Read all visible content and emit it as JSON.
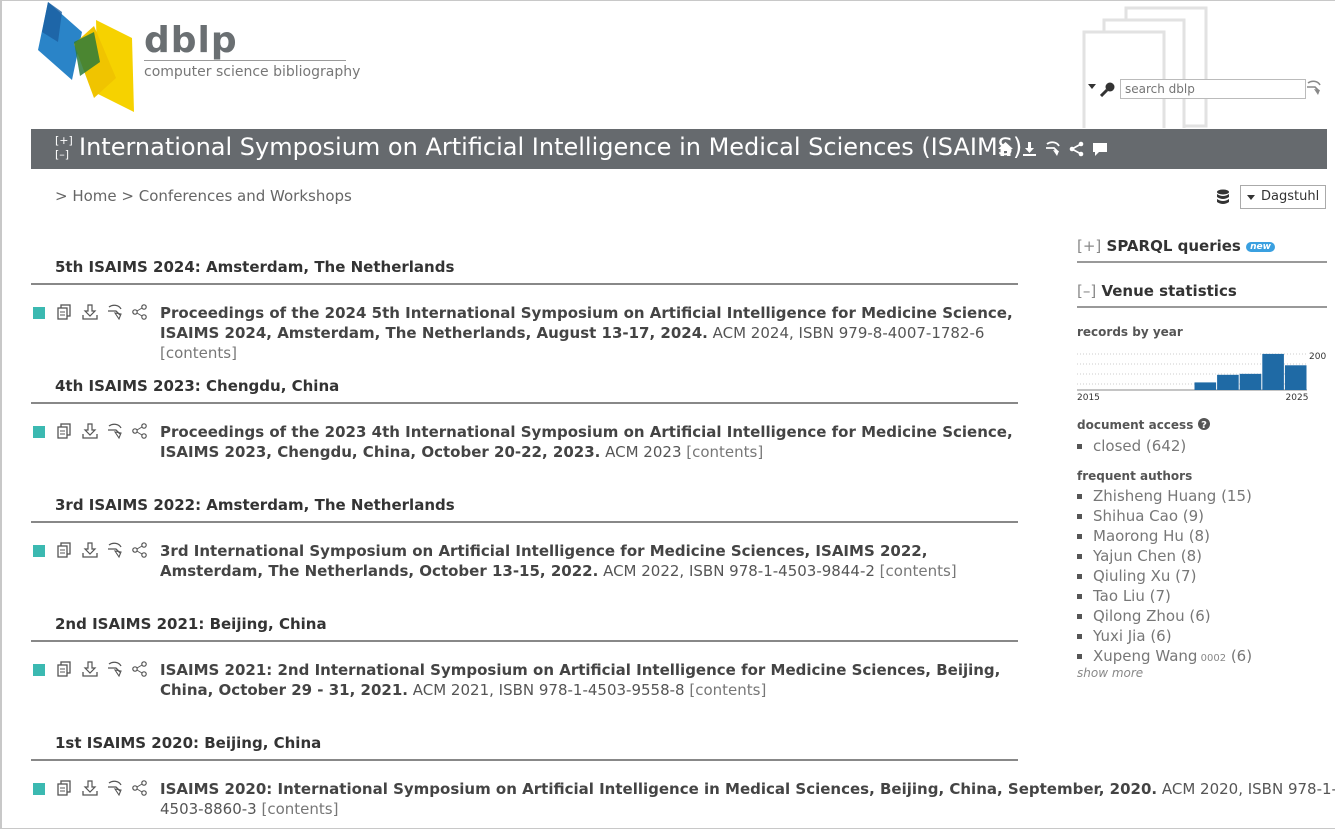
{
  "header": {
    "logo_big": "dblp",
    "logo_small": "computer science bibliography",
    "search_placeholder": "search dblp"
  },
  "title": {
    "expand": "[+]",
    "collapse": "[–]",
    "text": "International Symposium on Artificial Intelligence in Medical Sciences (ISAIMS)"
  },
  "breadcrumb": {
    "home": "> Home",
    "sep": " > ",
    "section": "Conferences and Workshops"
  },
  "mirror": {
    "selected": "Dagstuhl"
  },
  "sections": [
    {
      "heading": "5th ISAIMS 2024: Amsterdam, The Netherlands",
      "title": "Proceedings of the 2024 5th International Symposium on Artificial Intelligence for Medicine Science, ISAIMS 2024, Amsterdam, The Netherlands, August 13-17, 2024.",
      "meta": " ACM 2024, ISBN 979-8-4007-1782-6 ",
      "contents": "[contents]"
    },
    {
      "heading": "4th ISAIMS 2023: Chengdu, China",
      "title": "Proceedings of the 2023 4th International Symposium on Artificial Intelligence for Medicine Science, ISAIMS 2023, Chengdu, China, October 20-22, 2023.",
      "meta": " ACM 2023 ",
      "contents": "[contents]"
    },
    {
      "heading": "3rd ISAIMS 2022: Amsterdam, The Netherlands",
      "title": "3rd International Symposium on Artificial Intelligence for Medicine Sciences, ISAIMS 2022, Amsterdam, The Netherlands, October 13-15, 2022.",
      "meta": " ACM 2022, ISBN 978-1-4503-9844-2 ",
      "contents": "[contents]"
    },
    {
      "heading": "2nd ISAIMS 2021: Beijing, China",
      "title": "ISAIMS 2021: 2nd International Symposium on Artificial Intelligence for Medicine Sciences, Beijing, China, October 29 - 31, 2021.",
      "meta": " ACM 2021, ISBN 978-1-4503-9558-8 ",
      "contents": "[contents]"
    },
    {
      "heading": "1st ISAIMS 2020: Beijing, China",
      "title": "ISAIMS 2020: International Symposium on Artificial Intelligence in Medical Sciences, Beijing, China, September, 2020.",
      "meta": " ACM 2020, ISBN 978-1-4503-8860-3 ",
      "contents": "[contents]"
    }
  ],
  "sidebar": {
    "sparql_bracket": "[+]",
    "sparql_label": "SPARQL queries",
    "new_badge": "new",
    "venue_bracket": "[–]",
    "venue_label": "Venue statistics",
    "records_head": "records by year",
    "access_head": "document access",
    "access_item": "closed (642)",
    "authors_head": "frequent authors",
    "authors": [
      {
        "name": "Zhisheng Huang",
        "sub": "",
        "count": " (15)"
      },
      {
        "name": "Shihua Cao",
        "sub": "",
        "count": " (9)"
      },
      {
        "name": "Maorong Hu",
        "sub": "",
        "count": " (8)"
      },
      {
        "name": "Yajun Chen",
        "sub": "",
        "count": " (8)"
      },
      {
        "name": "Qiuling Xu",
        "sub": "",
        "count": " (7)"
      },
      {
        "name": "Tao Liu",
        "sub": "",
        "count": " (7)"
      },
      {
        "name": "Qilong Zhou",
        "sub": "",
        "count": " (6)"
      },
      {
        "name": "Yuxi Jia",
        "sub": "",
        "count": " (6)"
      },
      {
        "name": "Xupeng Wang",
        "sub": " 0002",
        "count": " (6)"
      }
    ],
    "show_more": "show more"
  },
  "chart_data": {
    "type": "bar",
    "title": "records by year",
    "categories": [
      "2015",
      "2016",
      "2017",
      "2018",
      "2019",
      "2020",
      "2021",
      "2022",
      "2023",
      "2024",
      "2025"
    ],
    "values": [
      0,
      0,
      0,
      0,
      0,
      40,
      80,
      85,
      190,
      130,
      0
    ],
    "x_tick_labels": [
      "2015",
      "2025"
    ],
    "y_tick_labels": [
      "200"
    ],
    "ylim": [
      0,
      200
    ],
    "color": "#1f6aa5",
    "grid": "dotted"
  },
  "colors": {
    "titlebar": "#666a6e",
    "marker": "#3bb9b1",
    "bar": "#1f6aa5"
  }
}
